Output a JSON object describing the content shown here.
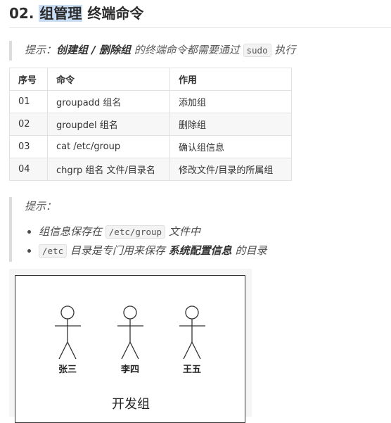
{
  "heading": {
    "number": "02.",
    "highlight": "组管理",
    "rest": " 终端命令"
  },
  "note1": {
    "prefix": "提示：",
    "bold": "创建组 / 删除组",
    "middle": " 的终端命令都需要通过 ",
    "code": "sudo",
    "suffix": " 执行"
  },
  "table": {
    "headers": [
      "序号",
      "命令",
      "作用"
    ],
    "rows": [
      [
        "01",
        "groupadd 组名",
        "添加组"
      ],
      [
        "02",
        "groupdel 组名",
        "删除组"
      ],
      [
        "03",
        "cat /etc/group",
        "确认组信息"
      ],
      [
        "04",
        "chgrp 组名 文件/目录名",
        "修改文件/目录的所属组"
      ]
    ]
  },
  "note2": {
    "title": "提示：",
    "item1": {
      "pre": "组信息保存在 ",
      "code": "/etc/group",
      "post": " 文件中"
    },
    "item2": {
      "code": "/etc",
      "pre": " 目录是专门用来保存 ",
      "bold": "系统配置信息",
      "post": " 的目录"
    }
  },
  "diagram": {
    "actors": [
      "张三",
      "李四",
      "王五"
    ],
    "group_label": "开发组"
  }
}
